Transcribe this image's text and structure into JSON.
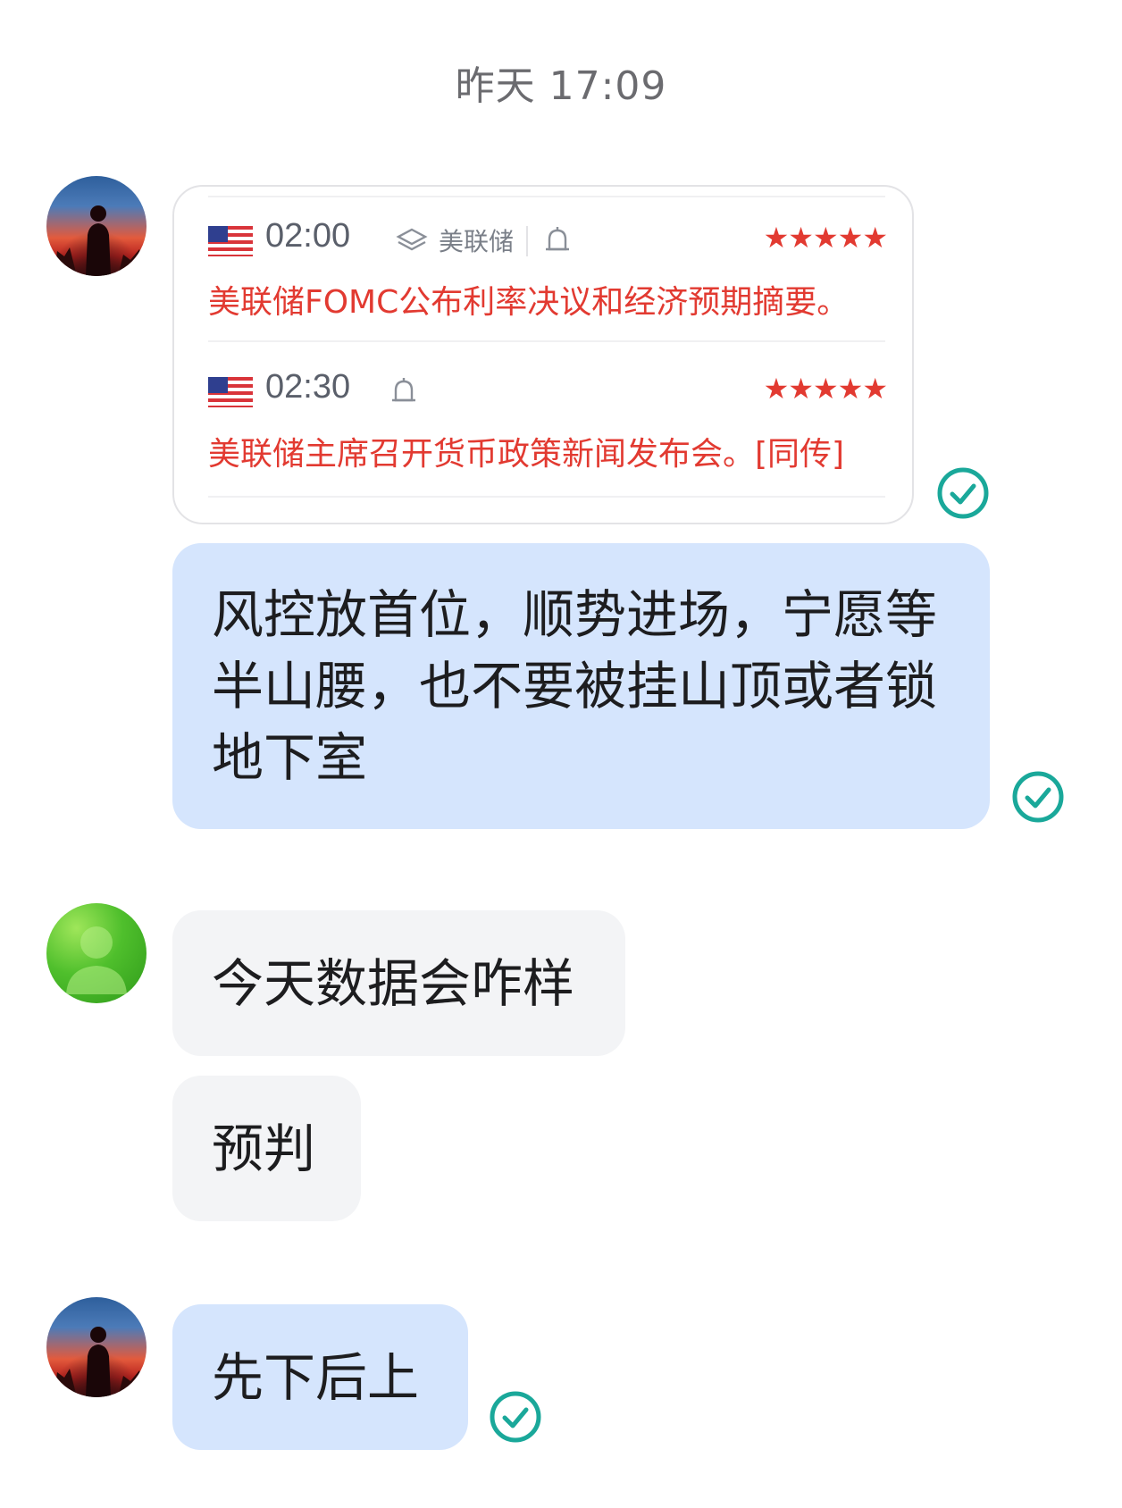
{
  "timestamp": "昨天 17:09",
  "card": {
    "events": [
      {
        "time": "02:00",
        "source": "美联储",
        "stars": "★★★★★",
        "title": "美联储FOMC公布利率决议和经济预期摘要。"
      },
      {
        "time": "02:30",
        "stars": "★★★★★",
        "title": "美联储主席召开货币政策新闻发布会。[同传]"
      }
    ]
  },
  "messages": [
    {
      "from": "self",
      "text_lines": [
        "风控放首位，顺势进场，宁愿等",
        "半山腰，也不要被挂山顶或者锁",
        "地下室"
      ]
    },
    {
      "from": "other",
      "text": "今天数据会咋样"
    },
    {
      "from": "other",
      "text": "预判"
    },
    {
      "from": "self",
      "text": "先下后上"
    }
  ],
  "icons": {
    "read_check": "check-circle-icon",
    "bell": "bell-icon",
    "layers": "layers-icon",
    "flag": "us-flag-icon"
  },
  "colors": {
    "accent_check": "#1aa89a",
    "event_red": "#e23a31",
    "bubble_out": "#d5e5fd",
    "bubble_in": "#f3f4f6"
  }
}
